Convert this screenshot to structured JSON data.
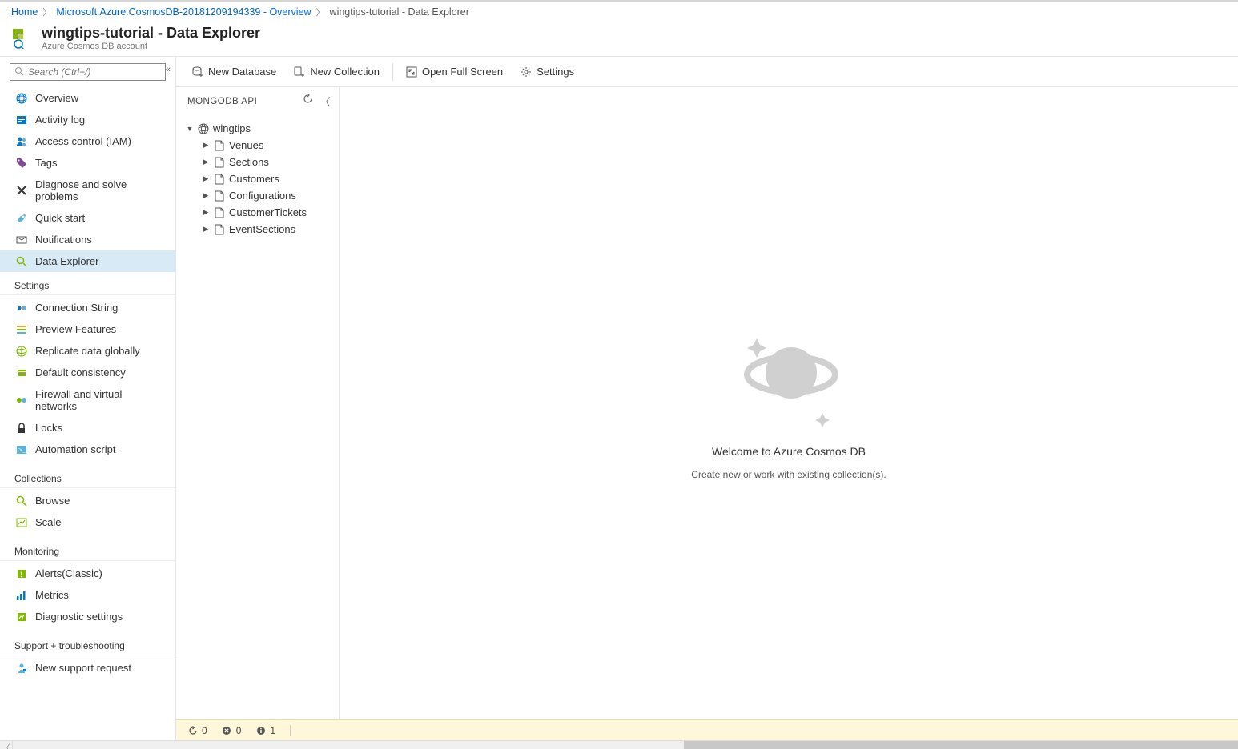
{
  "breadcrumb": {
    "home": "Home",
    "resource": "Microsoft.Azure.CosmosDB-20181209194339 - Overview",
    "current": "wingtips-tutorial - Data Explorer"
  },
  "header": {
    "title": "wingtips-tutorial - Data Explorer",
    "subtitle": "Azure Cosmos DB account"
  },
  "search": {
    "placeholder": "Search (Ctrl+/)"
  },
  "sidebar": {
    "top": [
      {
        "id": "overview",
        "label": "Overview",
        "icon": "overview"
      },
      {
        "id": "activity-log",
        "label": "Activity log",
        "icon": "activitylog"
      },
      {
        "id": "iam",
        "label": "Access control (IAM)",
        "icon": "iam"
      },
      {
        "id": "tags",
        "label": "Tags",
        "icon": "tags"
      },
      {
        "id": "diagnose",
        "label": "Diagnose and solve problems",
        "icon": "diagnose"
      },
      {
        "id": "quickstart",
        "label": "Quick start",
        "icon": "quickstart"
      },
      {
        "id": "notifications",
        "label": "Notifications",
        "icon": "notifications"
      },
      {
        "id": "data-explorer",
        "label": "Data Explorer",
        "icon": "dataexplorer",
        "active": true
      }
    ],
    "sections": [
      {
        "title": "Settings",
        "items": [
          {
            "label": "Connection String",
            "icon": "conn"
          },
          {
            "label": "Preview Features",
            "icon": "preview"
          },
          {
            "label": "Replicate data globally",
            "icon": "replicate"
          },
          {
            "label": "Default consistency",
            "icon": "consistency"
          },
          {
            "label": "Firewall and virtual networks",
            "icon": "firewall"
          },
          {
            "label": "Locks",
            "icon": "locks"
          },
          {
            "label": "Automation script",
            "icon": "automation"
          }
        ]
      },
      {
        "title": "Collections",
        "items": [
          {
            "label": "Browse",
            "icon": "browse"
          },
          {
            "label": "Scale",
            "icon": "scale"
          }
        ]
      },
      {
        "title": "Monitoring",
        "items": [
          {
            "label": "Alerts(Classic)",
            "icon": "alerts"
          },
          {
            "label": "Metrics",
            "icon": "metrics"
          },
          {
            "label": "Diagnostic settings",
            "icon": "diag"
          }
        ]
      },
      {
        "title": "Support + troubleshooting",
        "items": [
          {
            "label": "New support request",
            "icon": "support"
          }
        ]
      }
    ]
  },
  "toolbar": {
    "new_database": "New Database",
    "new_collection": "New Collection",
    "open_full_screen": "Open Full Screen",
    "settings": "Settings"
  },
  "tree": {
    "api_label": "MONGODB API",
    "database": "wingtips",
    "collections": [
      "Venues",
      "Sections",
      "Customers",
      "Configurations",
      "CustomerTickets",
      "EventSections"
    ]
  },
  "welcome": {
    "title": "Welcome to Azure Cosmos DB",
    "subtitle": "Create new or work with existing collection(s)."
  },
  "statusbar": {
    "refresh": "0",
    "errors": "0",
    "info": "1"
  }
}
